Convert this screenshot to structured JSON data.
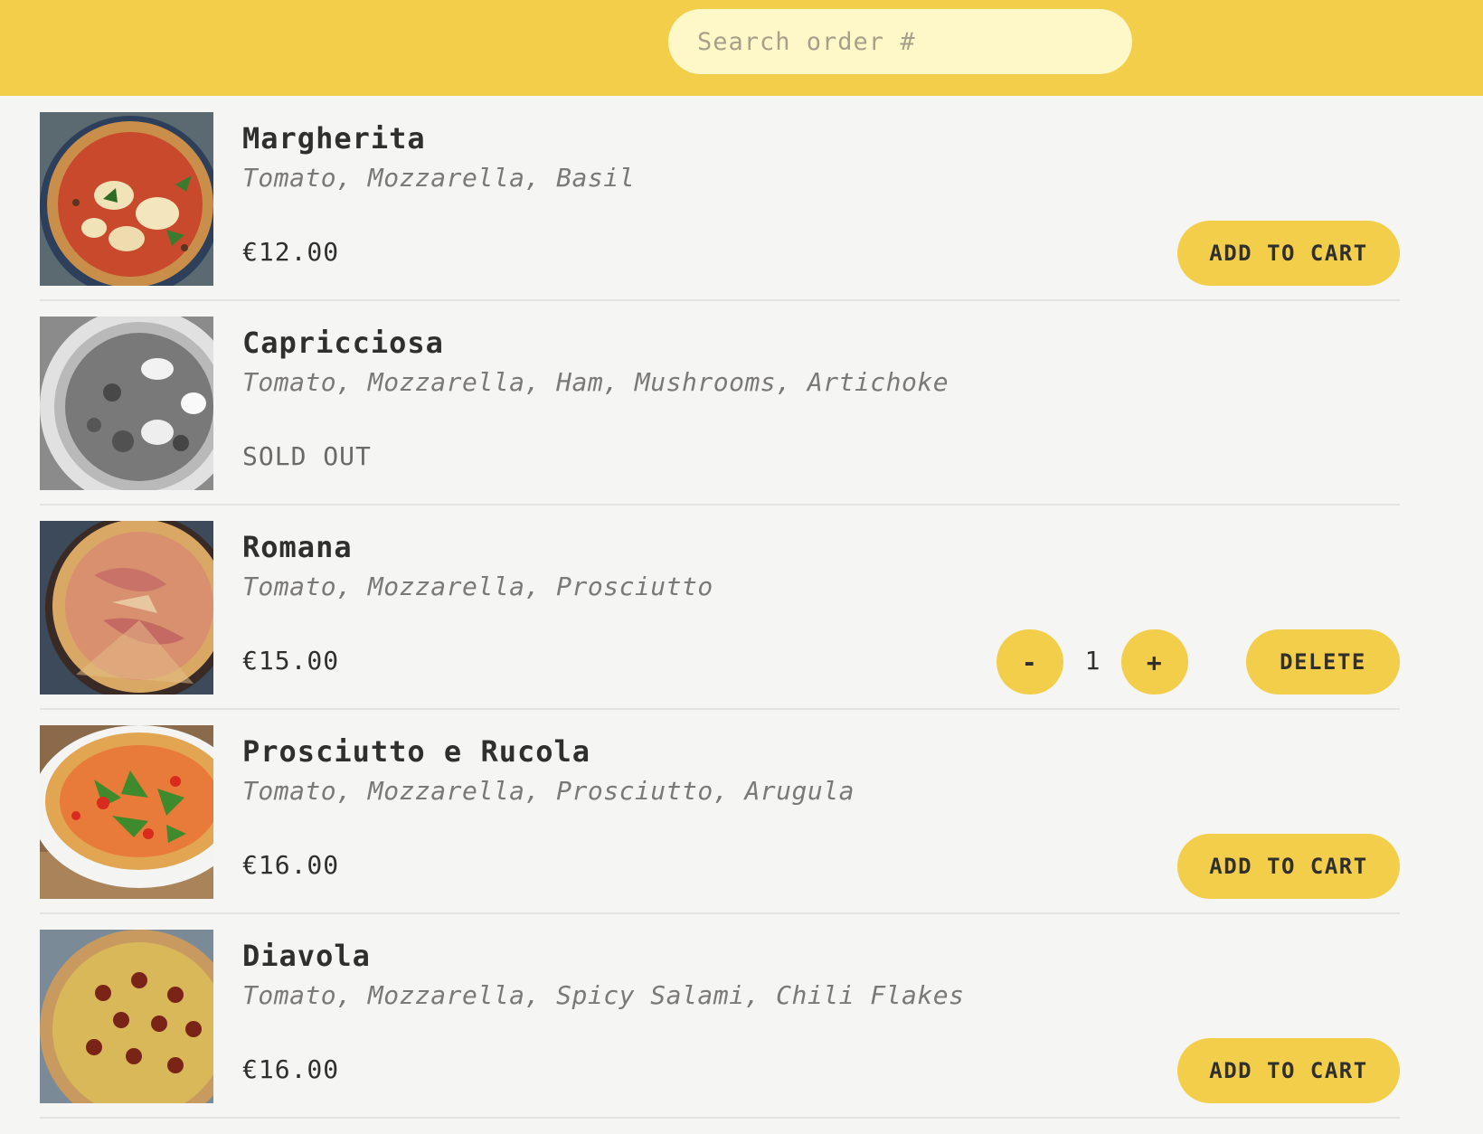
{
  "search": {
    "placeholder": "Search order #"
  },
  "menu": [
    {
      "name": "Margherita",
      "ingredients": "Tomato, Mozzarella, Basil",
      "price": "€12.00",
      "action": "ADD TO CART"
    },
    {
      "name": "Capricciosa",
      "ingredients": "Tomato, Mozzarella, Ham, Mushrooms, Artichoke",
      "status": "SOLD OUT"
    },
    {
      "name": "Romana",
      "ingredients": "Tomato, Mozzarella, Prosciutto",
      "price": "€15.00",
      "minus_label": "-",
      "quantity": "1",
      "plus_label": "+",
      "action": "DELETE"
    },
    {
      "name": "Prosciutto e Rucola",
      "ingredients": "Tomato, Mozzarella, Prosciutto, Arugula",
      "price": "€16.00",
      "action": "ADD TO CART"
    },
    {
      "name": "Diavola",
      "ingredients": "Tomato, Mozzarella, Spicy Salami, Chili Flakes",
      "price": "€16.00",
      "action": "ADD TO CART"
    }
  ],
  "colors": {
    "header": "#f3ce4b",
    "search_bg": "#fef8c8",
    "page_bg": "#f5f5f3",
    "button": "#f3ce4b"
  }
}
